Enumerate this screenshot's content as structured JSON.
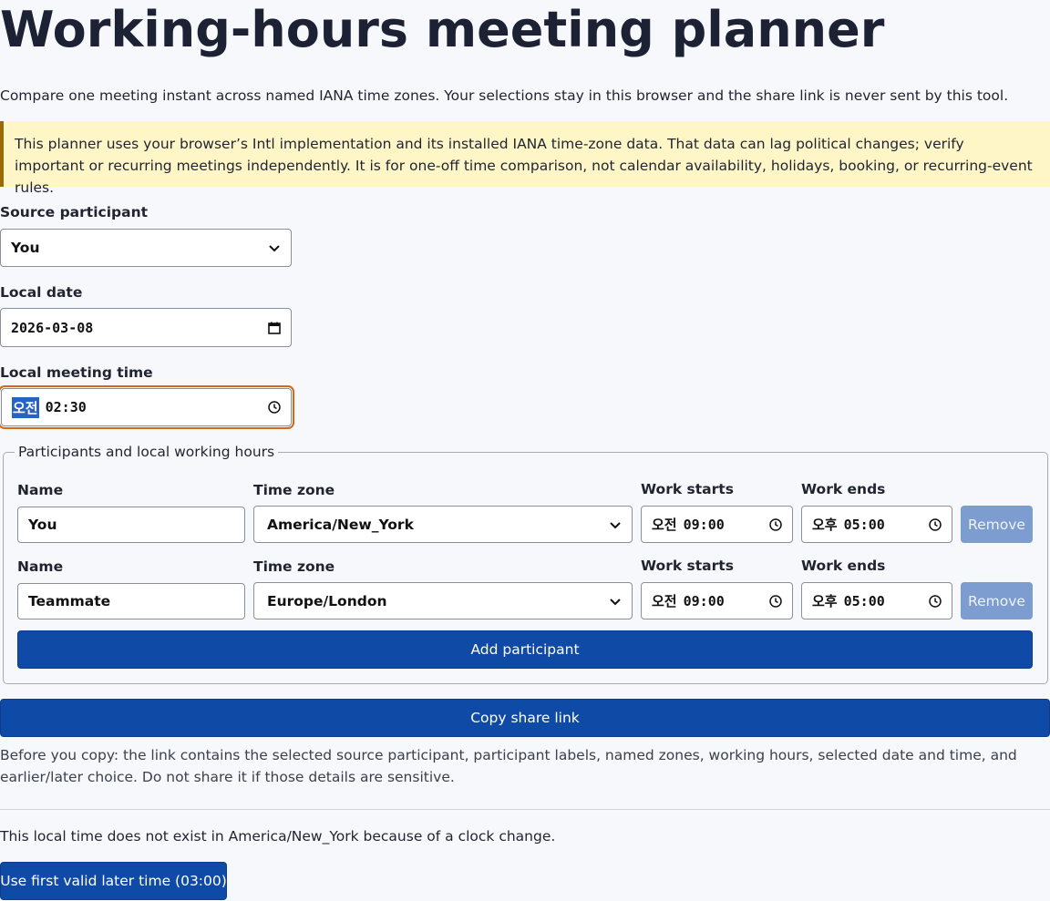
{
  "page": {
    "title": "Working-hours meeting planner",
    "intro": "Compare one meeting instant across named IANA time zones. Your selections stay in this browser and the share link is never sent by this tool.",
    "warning": "This planner uses your browser’s Intl implementation and its installed IANA time-zone data. That data can lag political changes; verify important or recurring meetings independently. It is for one-off time comparison, not calendar availability, holidays, booking, or recurring-event rules."
  },
  "form": {
    "source_label": "Source participant",
    "source_value": "You",
    "date_label": "Local date",
    "date_value": "2026-03-08",
    "time_label": "Local meeting time",
    "time_ampm": "오전",
    "time_value": "02:30"
  },
  "participants": {
    "legend": "Participants and local working hours",
    "col_name": "Name",
    "col_zone": "Time zone",
    "col_start": "Work starts",
    "col_end": "Work ends",
    "remove_label": "Remove",
    "add_label": "Add participant",
    "rows": [
      {
        "name": "You",
        "zone": "America/New_York",
        "start_ampm": "오전",
        "start": "09:00",
        "end_ampm": "오후",
        "end": "05:00"
      },
      {
        "name": "Teammate",
        "zone": "Europe/London",
        "start_ampm": "오전",
        "start": "09:00",
        "end_ampm": "오후",
        "end": "05:00"
      }
    ]
  },
  "share": {
    "button": "Copy share link",
    "note": "Before you copy: the link contains the selected source participant, participant labels, named zones, working hours, selected date and time, and earlier/later choice. Do not share it if those details are sensitive."
  },
  "status": {
    "message": "This local time does not exist in America/New_York because of a clock change.",
    "action": "Use first valid later time (03:00)"
  },
  "icons": [
    "chevron-down-icon",
    "calendar-icon",
    "clock-icon"
  ],
  "colors": {
    "primary": "#0f4aa6",
    "remove": "#7d9dd1",
    "warning_bg": "#fff6c8",
    "focus": "#d46a17"
  }
}
